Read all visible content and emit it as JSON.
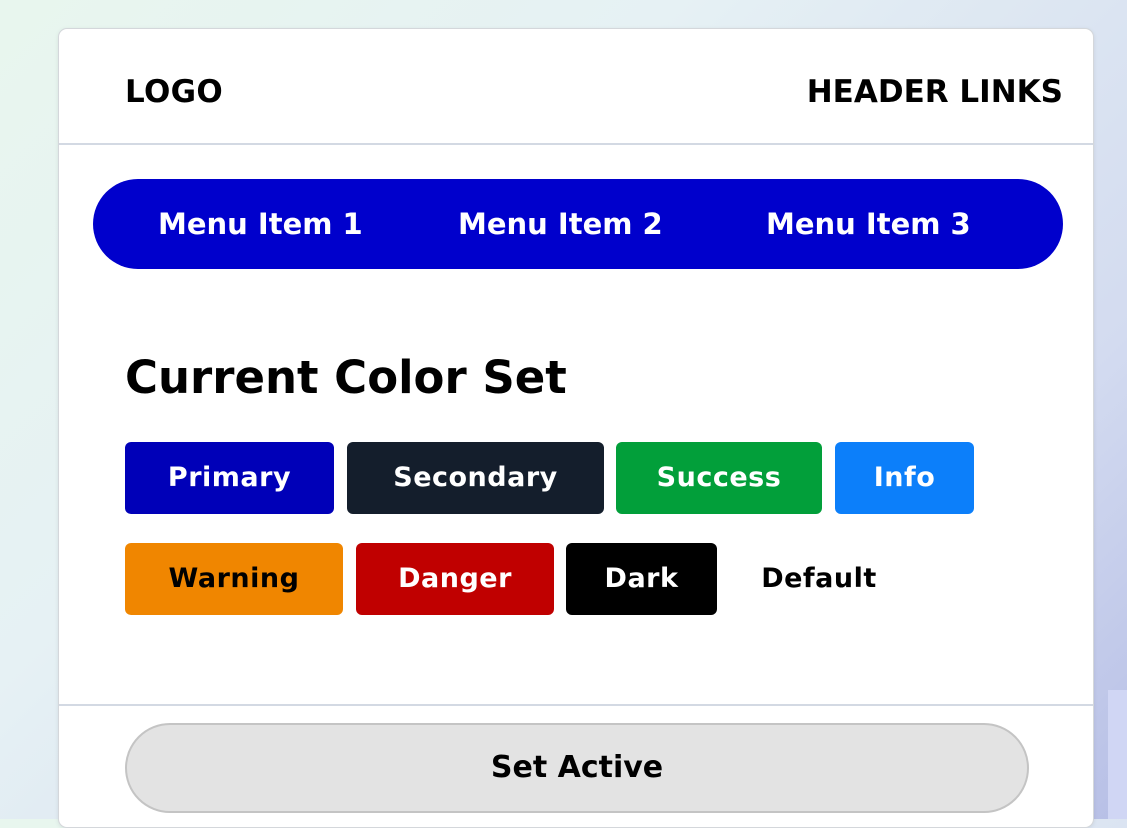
{
  "header": {
    "logo": "LOGO",
    "links": "HEADER LINKS"
  },
  "nav": {
    "background_color": "#0000cc",
    "items": [
      {
        "label": "Menu Item 1"
      },
      {
        "label": "Menu Item 2"
      },
      {
        "label": "Menu Item 3"
      }
    ]
  },
  "section": {
    "title": "Current Color Set"
  },
  "badges": [
    {
      "label": "Primary",
      "variant": "primary",
      "color": "#0000b8"
    },
    {
      "label": "Secondary",
      "variant": "secondary",
      "color": "#141e2c"
    },
    {
      "label": "Success",
      "variant": "success",
      "color": "#029f3a"
    },
    {
      "label": "Info",
      "variant": "info",
      "color": "#0c7ffa"
    },
    {
      "label": "Warning",
      "variant": "warning",
      "color": "#f08600"
    },
    {
      "label": "Danger",
      "variant": "danger",
      "color": "#c00000"
    },
    {
      "label": "Dark",
      "variant": "dark",
      "color": "#000000"
    },
    {
      "label": "Default",
      "variant": "default",
      "color": "transparent"
    }
  ],
  "footer": {
    "button_label": "Set Active"
  }
}
